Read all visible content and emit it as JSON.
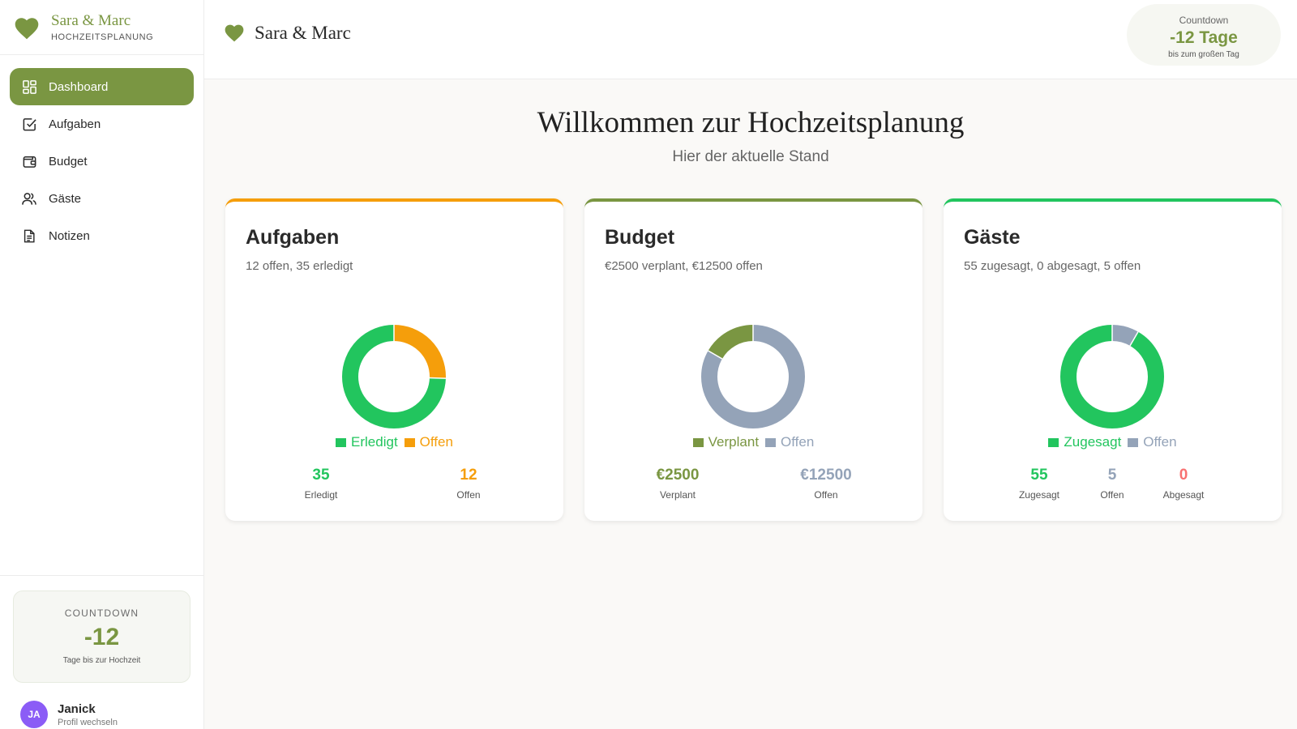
{
  "sidebar": {
    "brand_name": "Sara & Marc",
    "brand_sub": "HOCHZEITSPLANUNG",
    "items": [
      {
        "label": "Dashboard",
        "icon": "dashboard-icon",
        "active": true
      },
      {
        "label": "Aufgaben",
        "icon": "checkbox-icon"
      },
      {
        "label": "Budget",
        "icon": "wallet-icon"
      },
      {
        "label": "Gäste",
        "icon": "users-icon"
      },
      {
        "label": "Notizen",
        "icon": "document-icon"
      }
    ],
    "countdown": {
      "label": "COUNTDOWN",
      "value": "-12",
      "sub": "Tage bis zur Hochzeit"
    },
    "profile": {
      "initials": "JA",
      "name": "Janick",
      "sub": "Profil wechseln"
    }
  },
  "header": {
    "title": "Sara & Marc",
    "countdown": {
      "label": "Countdown",
      "value": "-12 Tage",
      "sub": "bis zum großen Tag"
    }
  },
  "main": {
    "title": "Willkommen zur Hochzeitsplanung",
    "subtitle": "Hier der aktuelle Stand"
  },
  "colors": {
    "accent": "#7a9642",
    "green": "#22c55e",
    "orange": "#f59e0b",
    "gray": "#94a3b8",
    "red": "#f87171",
    "purple": "#8b5cf6"
  },
  "cards": [
    {
      "title": "Aufgaben",
      "sub": "12 offen, 35 erledigt",
      "stats": [
        {
          "value": "35",
          "label": "Erledigt"
        },
        {
          "value": "12",
          "label": "Offen"
        }
      ]
    },
    {
      "title": "Budget",
      "sub": "€2500 verplant, €12500 offen",
      "stats": [
        {
          "value": "€2500",
          "label": "Verplant"
        },
        {
          "value": "€12500",
          "label": "Offen"
        }
      ]
    },
    {
      "title": "Gäste",
      "sub": "55 zugesagt, 0 abgesagt, 5 offen",
      "stats": [
        {
          "value": "55",
          "label": "Zugesagt"
        },
        {
          "value": "5",
          "label": "Offen"
        },
        {
          "value": "0",
          "label": "Abgesagt"
        }
      ]
    }
  ],
  "chart_data": [
    {
      "type": "pie",
      "categories": [
        "Erledigt",
        "Offen"
      ],
      "values": [
        35,
        12
      ],
      "colors": [
        "#22c55e",
        "#f59e0b"
      ],
      "legend": "bottom"
    },
    {
      "type": "pie",
      "categories": [
        "Verplant",
        "Offen"
      ],
      "values": [
        2500,
        12500
      ],
      "colors": [
        "#7a9642",
        "#94a3b8"
      ],
      "legend": "bottom"
    },
    {
      "type": "pie",
      "categories": [
        "Zugesagt",
        "Offen"
      ],
      "values": [
        55,
        5
      ],
      "colors": [
        "#22c55e",
        "#94a3b8"
      ],
      "legend": "bottom"
    }
  ]
}
